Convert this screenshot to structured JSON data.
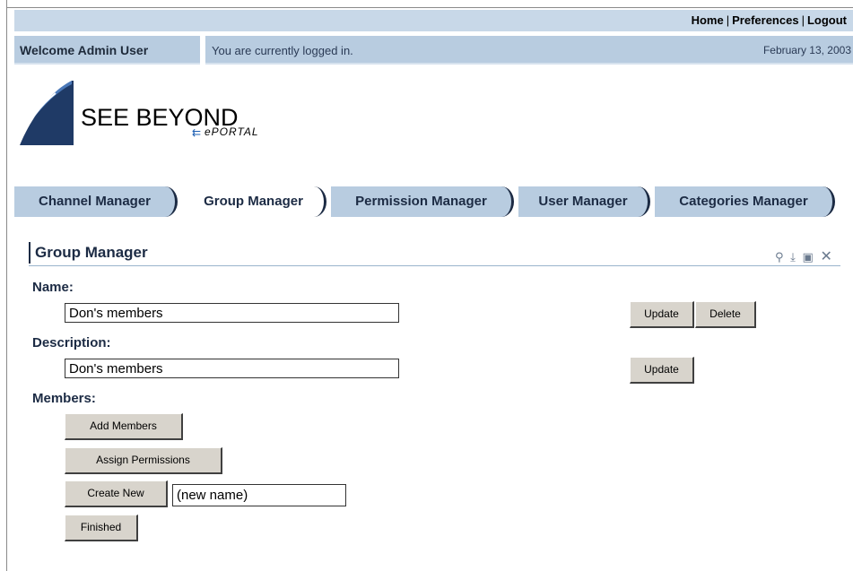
{
  "toplinks": {
    "home": "Home",
    "preferences": "Preferences",
    "logout": "Logout",
    "separator": "|"
  },
  "welcome": {
    "user": "Welcome Admin User",
    "status": "You are currently logged in.",
    "date": "February 13, 2003"
  },
  "logo": {
    "main": "SEE BEYOND",
    "sub": "ePORTAL"
  },
  "tabs": [
    {
      "label": "Channel Manager",
      "active": false
    },
    {
      "label": "Group Manager",
      "active": true
    },
    {
      "label": "Permission Manager",
      "active": false
    },
    {
      "label": "User Manager",
      "active": false
    },
    {
      "label": "Categories Manager",
      "active": false
    }
  ],
  "section": {
    "title": "Group Manager",
    "icons": [
      "search-icon",
      "download-icon",
      "edit-icon",
      "close-icon"
    ]
  },
  "form": {
    "name_label": "Name:",
    "name_value": "Don's members",
    "description_label": "Description:",
    "description_value": "Don's members",
    "members_label": "Members:",
    "update_label": "Update",
    "delete_label": "Delete",
    "add_members_label": "Add Members",
    "assign_permissions_label": "Assign Permissions",
    "create_new_label": "Create New",
    "new_name_value": "(new name)",
    "finished_label": "Finished"
  },
  "colors": {
    "accent": "#b8cce0",
    "topbar": "#c8d8e8",
    "heading": "#1c2b44",
    "button": "#d8d4cc"
  }
}
